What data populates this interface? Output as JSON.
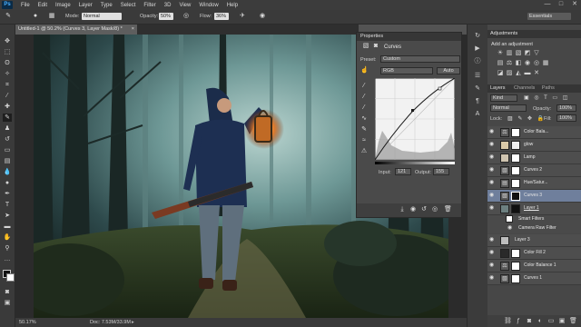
{
  "app": {
    "logo": "Ps"
  },
  "menu": [
    "File",
    "Edit",
    "Image",
    "Layer",
    "Type",
    "Select",
    "Filter",
    "3D",
    "View",
    "Window",
    "Help"
  ],
  "window_controls": {
    "minimize": "—",
    "maximize": "□",
    "close": "✕"
  },
  "options": {
    "mode_label": "Mode:",
    "mode_value": "Normal",
    "opacity_label": "Opacity:",
    "opacity_value": "50%",
    "flow_label": "Flow:",
    "flow_value": "36%",
    "workspace": "Essentials"
  },
  "document": {
    "tab_title": "Untitled-1 @ 50.2% (Curves 3, Layer Mask/8) *",
    "tab_close": "×"
  },
  "status": {
    "zoom": "50.17%",
    "doc": "Doc: 7.53M/33.9M"
  },
  "properties": {
    "tabs": [
      "Properties"
    ],
    "title": "Curves",
    "preset_label": "Preset:",
    "preset_value": "Custom",
    "channel_value": "RGB",
    "auto_label": "Auto",
    "input_label": "Input:",
    "input_value": "121",
    "output_label": "Output:",
    "output_value": "155"
  },
  "adjustments": {
    "tab": "Adjustments",
    "subtitle": "Add an adjustment"
  },
  "layers_panel": {
    "tabs": [
      "Layers",
      "Channels",
      "Paths"
    ],
    "filter_value": "Kind",
    "blend_value": "Normal",
    "opacity_label": "Opacity:",
    "opacity_value": "100%",
    "lock_label": "Lock:",
    "fill_label": "Fill:",
    "fill_value": "100%"
  },
  "layers": [
    {
      "name": "Color Bala..."
    },
    {
      "name": "glow"
    },
    {
      "name": "Lamp"
    },
    {
      "name": "Curves 2"
    },
    {
      "name": "Hue/Satur..."
    },
    {
      "name": "Curves 3"
    },
    {
      "name": "Layer 1"
    },
    {
      "name": "Smart Filters"
    },
    {
      "name": "Camera Raw Filter"
    },
    {
      "name": "Layer 3"
    },
    {
      "name": "Color Fill 2"
    },
    {
      "name": "Color Balance 1"
    },
    {
      "name": "Curves 1"
    }
  ],
  "colors": {
    "selection": "#6f7f9c",
    "panel": "#474747",
    "menubar": "#3c3c3c"
  }
}
